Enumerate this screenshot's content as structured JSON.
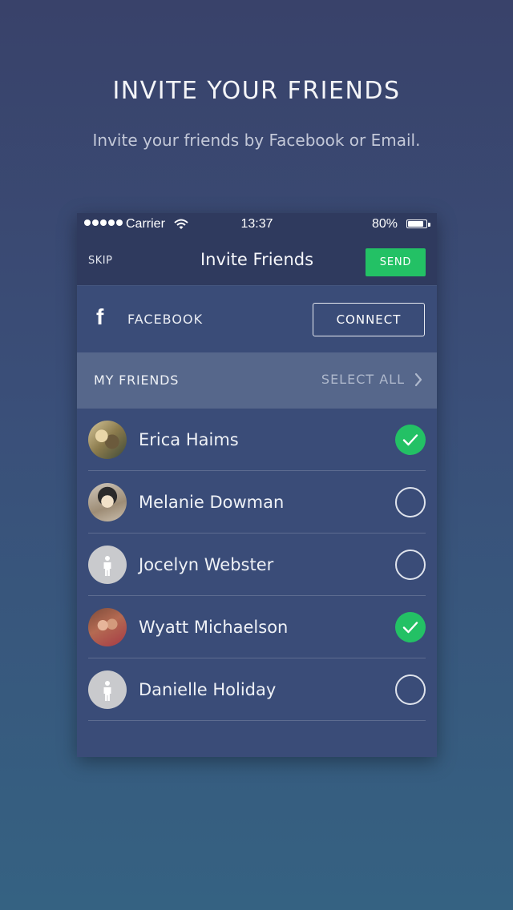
{
  "hero": {
    "title": "INVITE YOUR FRIENDS",
    "subtitle": "Invite your friends by Facebook or Email."
  },
  "status_bar": {
    "carrier": "Carrier",
    "time": "13:37",
    "battery_percent": "80%",
    "battery_level": 0.8,
    "signal_dots": 5
  },
  "nav": {
    "skip_label": "SKIP",
    "title": "Invite Friends",
    "send_label": "SEND"
  },
  "facebook": {
    "label": "FACEBOOK",
    "connect_label": "CONNECT"
  },
  "friends_header": {
    "title": "MY FRIENDS",
    "select_all_label": "SELECT ALL"
  },
  "friends": [
    {
      "name": "Erica Haims",
      "selected": true,
      "avatar": "photo"
    },
    {
      "name": "Melanie Dowman",
      "selected": false,
      "avatar": "photo"
    },
    {
      "name": "Jocelyn Webster",
      "selected": false,
      "avatar": "placeholder"
    },
    {
      "name": "Wyatt Michaelson",
      "selected": true,
      "avatar": "photo"
    },
    {
      "name": "Danielle Holiday",
      "selected": false,
      "avatar": "placeholder"
    }
  ],
  "colors": {
    "accent_green": "#23c165",
    "nav_background": "#2f3a5e",
    "section_header": "#56678b"
  },
  "icons": {
    "facebook": "facebook-icon",
    "chevron": "chevron-right-icon",
    "check": "checkmark-icon",
    "wifi": "wifi-icon",
    "battery": "battery-icon",
    "person": "person-icon"
  }
}
